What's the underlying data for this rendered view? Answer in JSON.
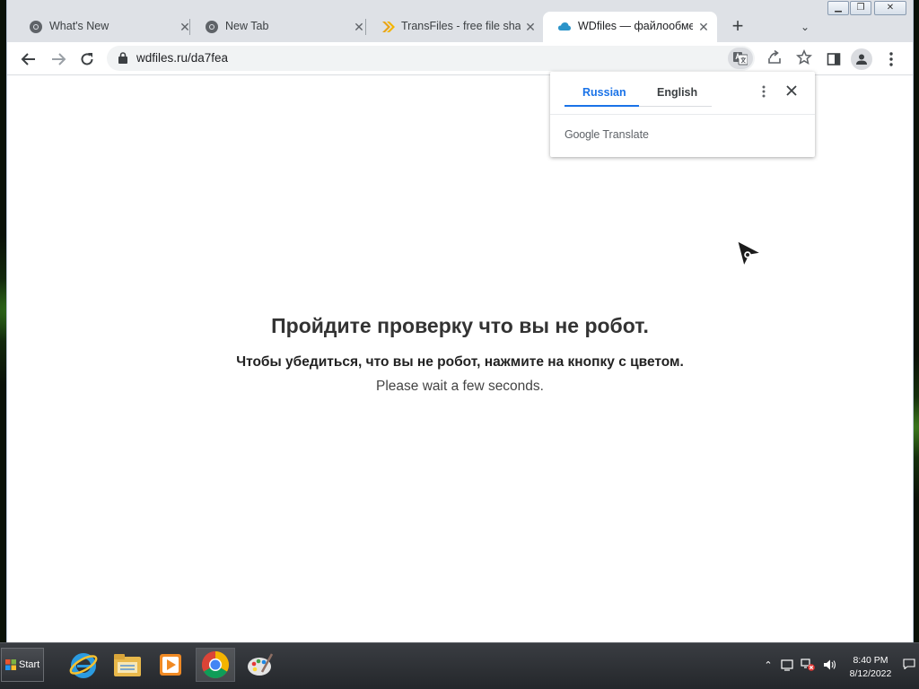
{
  "tabs": [
    {
      "title": "What's New",
      "icon": "chrome-icon"
    },
    {
      "title": "New Tab",
      "icon": "chrome-icon"
    },
    {
      "title": "TransFiles - free file shar",
      "icon": "transfiles-icon"
    },
    {
      "title": "WDfiles — файлообмен",
      "icon": "cloud-icon",
      "active": true
    }
  ],
  "address_bar": {
    "url": "wdfiles.ru/da7fea"
  },
  "translate_popup": {
    "source_lang": "Russian",
    "target_lang": "English",
    "brand_google": "Google",
    "brand_translate": "Translate"
  },
  "page": {
    "heading": "Пройдите проверку что вы не робот.",
    "subtitle": "Чтобы убедиться, что вы не робот, нажмите на кнопку с цветом.",
    "wait_text": "Please wait a few seconds."
  },
  "taskbar": {
    "start_label": "Start",
    "apps": [
      "internet-explorer-icon",
      "file-explorer-icon",
      "media-player-icon",
      "chrome-icon",
      "paint-icon"
    ],
    "clock_time": "8:40 PM",
    "clock_date": "8/12/2022"
  },
  "colors": {
    "accent": "#1a73e8",
    "tabstrip": "#dee1e6",
    "taskbar": "#2b2e32"
  }
}
